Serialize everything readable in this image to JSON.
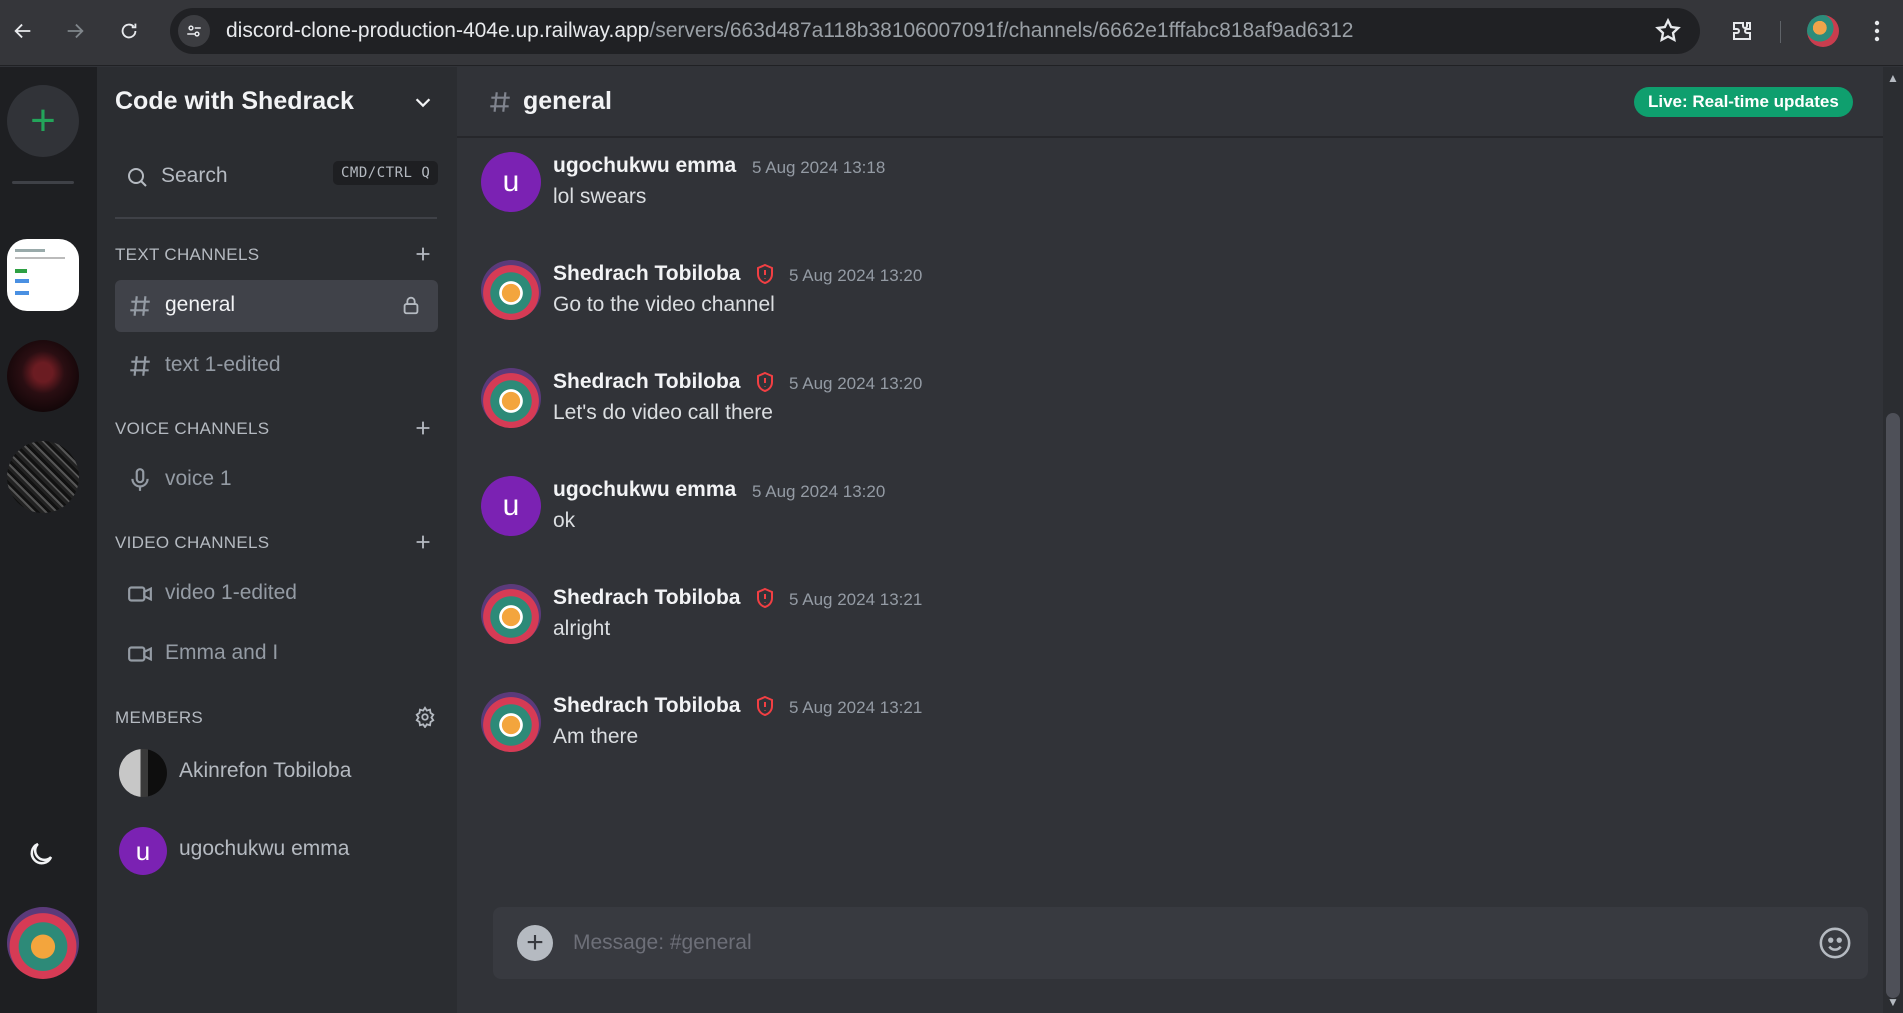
{
  "browser": {
    "url_host": "discord-clone-production-404e.up.railway.app",
    "url_path": "/servers/663d487a118b38106007091f/channels/6662e1fffabc818af9ad6312"
  },
  "rail": {
    "add_server_label": "+"
  },
  "server": {
    "name": "Code with Shedrack"
  },
  "search": {
    "label": "Search",
    "shortcut": "CMD/CTRL Q"
  },
  "sections": {
    "text": "TEXT CHANNELS",
    "voice": "VOICE CHANNELS",
    "video": "VIDEO CHANNELS",
    "members": "MEMBERS"
  },
  "text_channels": [
    {
      "label": "general",
      "active": true
    },
    {
      "label": "text 1-edited",
      "active": false
    }
  ],
  "voice_channels": [
    {
      "label": "voice 1"
    }
  ],
  "video_channels": [
    {
      "label": "video 1-edited"
    },
    {
      "label": "Emma and I"
    }
  ],
  "members": [
    {
      "name": "Akinrefon Tobiloba",
      "initial": ""
    },
    {
      "name": "ugochukwu emma",
      "initial": "u"
    }
  ],
  "chat": {
    "channel": "general",
    "live_badge": "Live: Real-time updates",
    "composer_placeholder": "Message: #general"
  },
  "messages": [
    {
      "author": "ugochukwu emma",
      "initial": "u",
      "admin": false,
      "time": "5 Aug 2024 13:18",
      "text": "lol swears"
    },
    {
      "author": "Shedrach Tobiloba",
      "initial": "",
      "admin": true,
      "time": "5 Aug 2024 13:20",
      "text": "Go to the video channel"
    },
    {
      "author": "Shedrach Tobiloba",
      "initial": "",
      "admin": true,
      "time": "5 Aug 2024 13:20",
      "text": "Let's do video call there"
    },
    {
      "author": "ugochukwu emma",
      "initial": "u",
      "admin": false,
      "time": "5 Aug 2024 13:20",
      "text": "ok"
    },
    {
      "author": "Shedrach Tobiloba",
      "initial": "",
      "admin": true,
      "time": "5 Aug 2024 13:21",
      "text": "alright"
    },
    {
      "author": "Shedrach Tobiloba",
      "initial": "",
      "admin": true,
      "time": "5 Aug 2024 13:21",
      "text": "Am there"
    }
  ],
  "colors": {
    "accent_green": "#23a55a",
    "live_badge": "#0f9f6e",
    "admin_shield": "#f23f43",
    "avatar_purple": "#7b22b3"
  }
}
